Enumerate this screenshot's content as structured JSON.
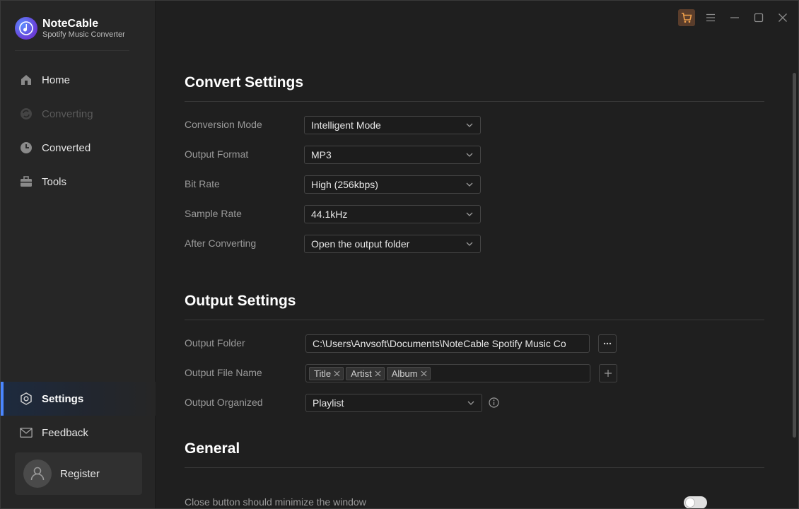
{
  "brand": {
    "name": "NoteCable",
    "subtitle": "Spotify Music Converter"
  },
  "sidebar": {
    "items": [
      {
        "label": "Home",
        "icon": "home-icon",
        "state": "normal"
      },
      {
        "label": "Converting",
        "icon": "sync-icon",
        "state": "disabled"
      },
      {
        "label": "Converted",
        "icon": "clock-icon",
        "state": "normal"
      },
      {
        "label": "Tools",
        "icon": "toolbox-icon",
        "state": "normal"
      }
    ],
    "bottom_items": [
      {
        "label": "Settings",
        "icon": "gear-icon",
        "state": "active"
      },
      {
        "label": "Feedback",
        "icon": "mail-icon",
        "state": "normal"
      }
    ],
    "register_label": "Register"
  },
  "titlebar": {
    "icons": [
      "cart-icon",
      "menu-icon",
      "minimize-icon",
      "maximize-icon",
      "close-icon"
    ]
  },
  "convert_settings": {
    "title": "Convert Settings",
    "rows": [
      {
        "label": "Conversion Mode",
        "value": "Intelligent Mode"
      },
      {
        "label": "Output Format",
        "value": "MP3"
      },
      {
        "label": "Bit Rate",
        "value": "High (256kbps)"
      },
      {
        "label": "Sample Rate",
        "value": "44.1kHz"
      },
      {
        "label": "After Converting",
        "value": "Open the output folder"
      }
    ]
  },
  "output_settings": {
    "title": "Output Settings",
    "folder_label": "Output Folder",
    "folder_value": "C:\\Users\\Anvsoft\\Documents\\NoteCable Spotify Music Co",
    "filename_label": "Output File Name",
    "filename_tags": [
      "Title",
      "Artist",
      "Album"
    ],
    "organized_label": "Output Organized",
    "organized_value": "Playlist"
  },
  "general": {
    "title": "General",
    "close_minimize_label": "Close button should minimize the window",
    "close_minimize_enabled": false
  },
  "colors": {
    "accent": "#4a86ff",
    "cart": "#f0a04b",
    "background": "#1f1f1f",
    "sidebar": "#262626"
  }
}
